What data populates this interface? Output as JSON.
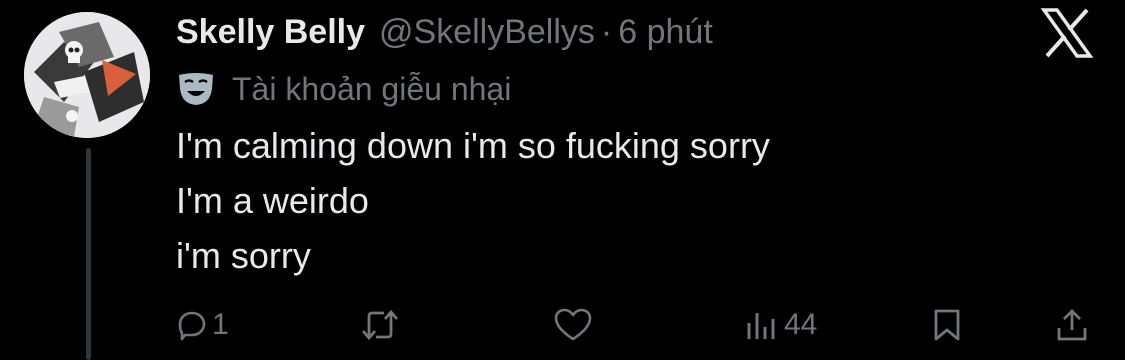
{
  "author": {
    "name": "Skelly Belly",
    "handle": "@SkellyBellys",
    "separator": "·",
    "time": "6 phút"
  },
  "parody_label": "Tài khoản giễu nhại",
  "post_lines": [
    "I'm calming down i'm so fucking sorry",
    "I'm a weirdo",
    "i'm sorry"
  ],
  "metrics": {
    "replies": "1",
    "views": "44"
  },
  "colors": {
    "background": "#000000",
    "text": "#e7e9ea",
    "muted": "#71767b",
    "thread_line": "#333639"
  },
  "icons": [
    "x-logo-icon",
    "parody-mask-icon",
    "reply-icon",
    "repost-icon",
    "like-icon",
    "views-icon",
    "bookmark-icon",
    "share-icon"
  ]
}
